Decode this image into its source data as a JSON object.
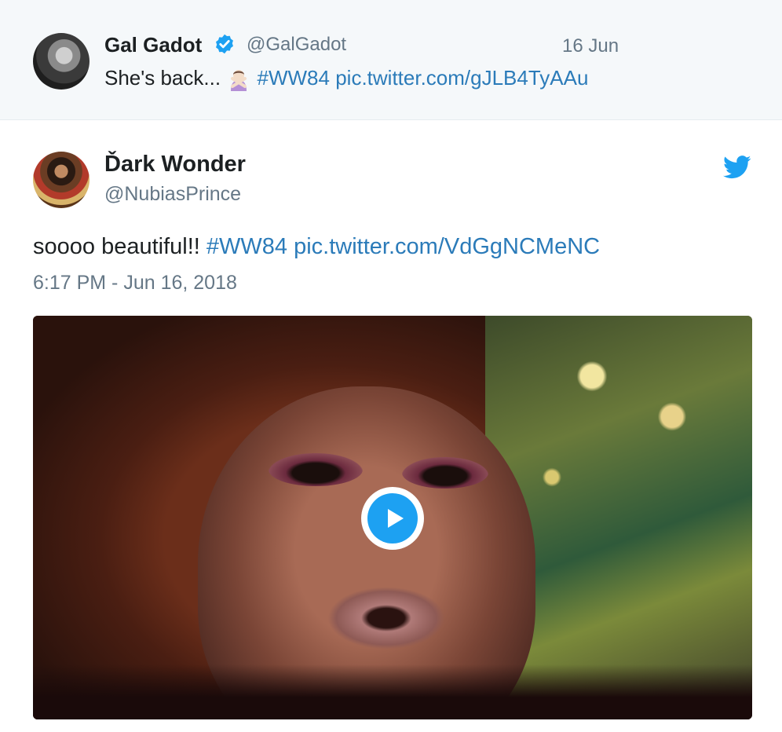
{
  "quoted_tweet": {
    "name": "Gal Gadot",
    "handle": "@GalGadot",
    "date": "16 Jun",
    "text_prefix": "She's back... ",
    "hashtag": "#WW84",
    "link": "pic.twitter.com/gJLB4TyAAu",
    "emoji_icon": "person-gesturing-no-emoji"
  },
  "embedded_tweet": {
    "name": "Ďark Wonder",
    "handle": "@NubiasPrince",
    "text_prefix": "soooo beautiful!! ",
    "hashtag": "#WW84",
    "link": "pic.twitter.com/VdGgNCMeNC",
    "timestamp": "6:17 PM - Jun 16, 2018",
    "brand_icon": "twitter-bird-icon",
    "media": {
      "type": "video",
      "play_icon": "play-icon"
    }
  },
  "colors": {
    "link": "#2b7bb9",
    "twitter_blue": "#1da1f2",
    "secondary_text": "#657786",
    "quoted_background": "#f5f8fa"
  }
}
